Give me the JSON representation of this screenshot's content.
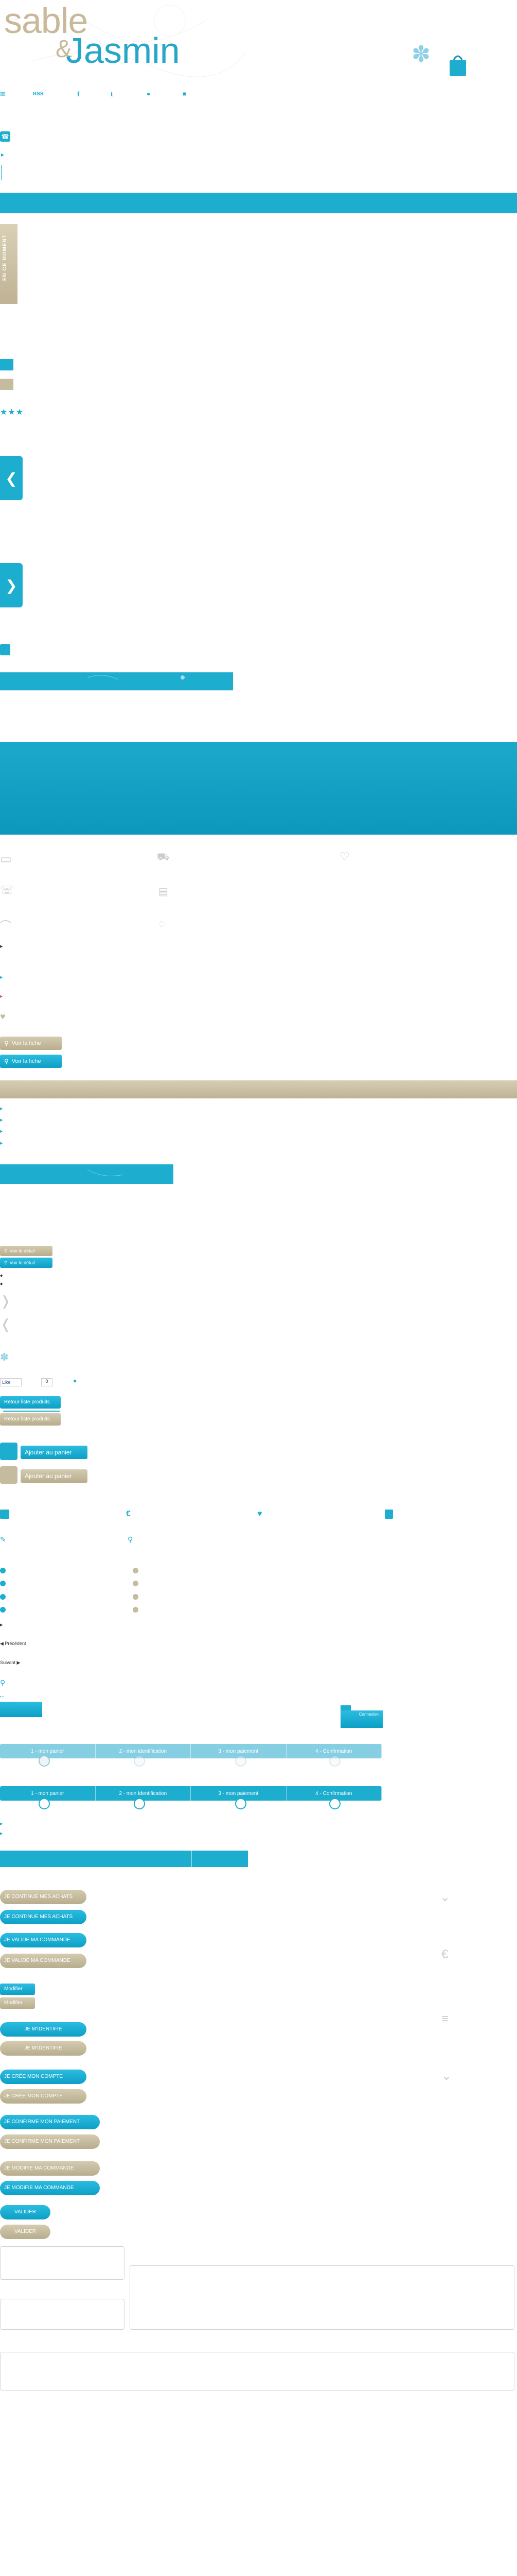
{
  "brand": {
    "logo_line1": "sable",
    "logo_amp": "&",
    "logo_line2": "Jasmin"
  },
  "topbar": {
    "icons": [
      "mail-icon",
      "rss-icon",
      "facebook-icon",
      "twitter-icon",
      "user-icon",
      "lock-icon"
    ],
    "rss": "RSS",
    "fb": "f",
    "tw": "t"
  },
  "ribbon": {
    "label": "EN CE MOMENT"
  },
  "sprites": {
    "star_rating": "★★★",
    "prev_arrow": "❮",
    "next_arrow": "❯"
  },
  "product_links": {
    "voir_fiche_1": "Voir la fiche",
    "voir_fiche_2": "Voir la fiche",
    "voir_detail_1": "Voir le détail",
    "voir_detail_2": "Voir le détail"
  },
  "social": {
    "like": "Like",
    "count": "0"
  },
  "back_buttons": {
    "teal": "Retour liste produits",
    "beige": "Retour liste produits"
  },
  "cart_buttons": {
    "teal": "Ajouter au panier",
    "beige": "Ajouter au panier"
  },
  "pagination": {
    "previous": "◀ Précédent",
    "next": "Suivant ▶"
  },
  "order_steps": {
    "steps": [
      "1 - mon panier",
      "2 - mon identification",
      "3 - mon paiement",
      "4 - Confirmation"
    ],
    "big_steps": [
      "1 - mon panier",
      "2 - mon Identification",
      "3 - mon paiement",
      "4 - Confirmation"
    ]
  },
  "order_small": {
    "label": "Connexion"
  },
  "checkout_buttons": {
    "continue_beige": "JE CONTINUE MES ACHATS",
    "continue_teal": "JE CONTINUE MES ACHATS",
    "validate_teal": "JE VALIDE MA COMMANDE",
    "validate_beige": "JE VALIDE MA COMMANDE",
    "modify_teal": "Modifier",
    "modify_beige": "Modifier",
    "identify_teal": "JE M'IDENTIFIE",
    "identify_beige": "JE M'IDENTIFIE",
    "create_teal": "JE CRÉE MON COMPTE",
    "create_beige": "JE CRÉE MON COMPTE",
    "confirm_teal": "JE CONFIRME MON PAIEMENT",
    "confirm_beige": "JE CONFIRME MON PAIEMENT",
    "modify_order_beige": "JE MODIFIE MA COMMANDE",
    "modify_order_teal": "JE MODIFIE MA COMMANDE",
    "valider_teal": "VALIDER",
    "valider_beige": "VALIDER"
  },
  "colors": {
    "teal": "#1cadcf",
    "beige": "#c5bb9f"
  }
}
